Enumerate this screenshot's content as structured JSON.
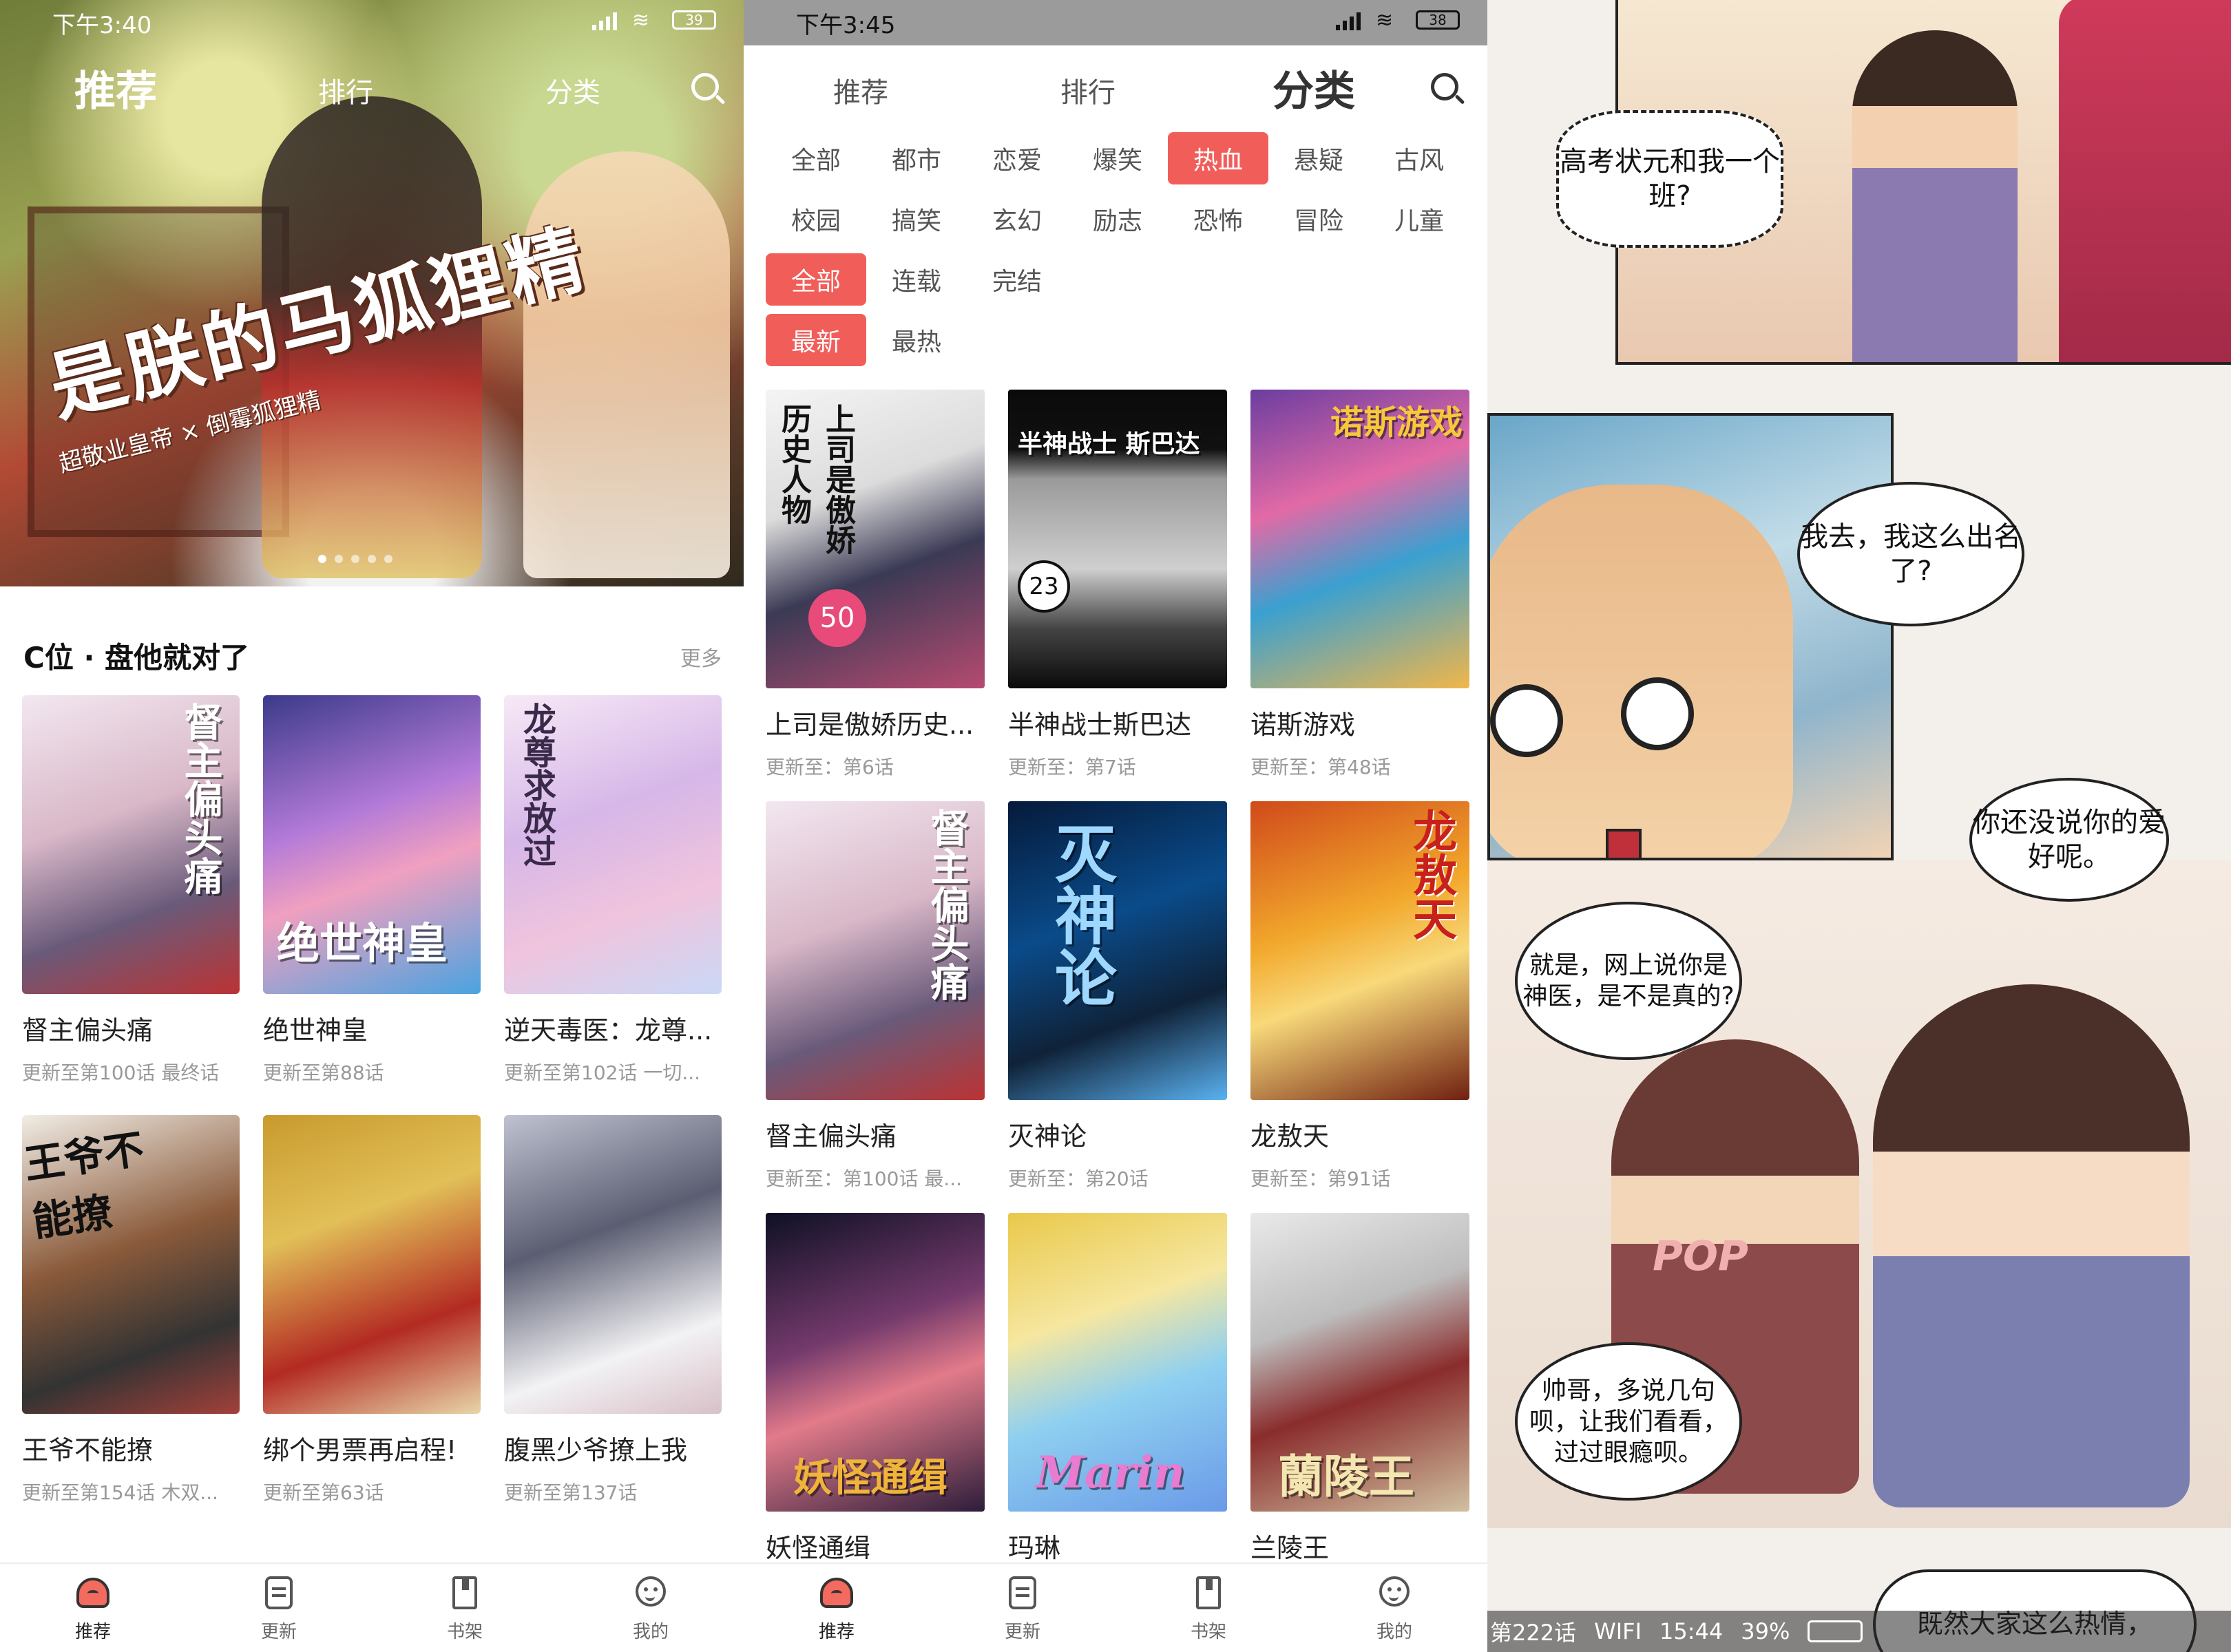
{
  "panel1": {
    "status_time": "下午3:40",
    "battery": "39",
    "nav": {
      "tab1": "推荐",
      "tab2": "排行",
      "tab3": "分类"
    },
    "banner": {
      "title": "是朕的马狐狸精",
      "subtitle": "超敬业皇帝 × 倒霉狐狸精"
    },
    "section": {
      "title": "C位 · 盘他就对了",
      "more": "更多"
    },
    "items": [
      {
        "title": "督主偏头痛",
        "sub": "更新至第100话 最终话",
        "cover_text": "督主偏头痛"
      },
      {
        "title": "绝世神皇",
        "sub": "更新至第88话",
        "cover_text": "绝世神皇"
      },
      {
        "title": "逆天毒医：龙尊...",
        "sub": "更新至第102话 一切...",
        "cover_text": "龙尊求放过"
      },
      {
        "title": "王爷不能撩",
        "sub": "更新至第154话 木双...",
        "cover_text": "王爷不能撩"
      },
      {
        "title": "绑个男票再启程!",
        "sub": "更新至第63话",
        "cover_text": ""
      },
      {
        "title": "腹黑少爷撩上我",
        "sub": "更新至第137话",
        "cover_text": ""
      }
    ],
    "bottom": [
      "推荐",
      "更新",
      "书架",
      "我的"
    ]
  },
  "panel2": {
    "status_time": "下午3:45",
    "battery": "38",
    "nav": {
      "tab1": "推荐",
      "tab2": "排行",
      "tab3": "分类"
    },
    "filters": {
      "row1": [
        "全部",
        "都市",
        "恋爱",
        "爆笑",
        "热血",
        "悬疑",
        "古风"
      ],
      "row2": [
        "校园",
        "搞笑",
        "玄幻",
        "励志",
        "恐怖",
        "冒险",
        "儿童"
      ],
      "row3": [
        "全部",
        "连载",
        "完结"
      ],
      "row4": [
        "最新",
        "最热"
      ]
    },
    "items": [
      {
        "title": "上司是傲娇历史...",
        "sub": "更新至：第6话",
        "cover_text": "上司是傲娇历史人物",
        "badge": "50"
      },
      {
        "title": "半神战士斯巴达",
        "sub": "更新至：第7话",
        "cover_text": "半神战士 斯巴达",
        "badge": "23"
      },
      {
        "title": "诺斯游戏",
        "sub": "更新至：第48话",
        "cover_text": "诺斯游戏"
      },
      {
        "title": "督主偏头痛",
        "sub": "更新至：第100话 最...",
        "cover_text": "督主偏头痛"
      },
      {
        "title": "灭神论",
        "sub": "更新至：第20话",
        "cover_text": "灭神论"
      },
      {
        "title": "龙敖天",
        "sub": "更新至：第91话",
        "cover_text": "龙敖天"
      },
      {
        "title": "妖怪通缉",
        "sub": "",
        "cover_text": "妖怪通缉"
      },
      {
        "title": "玛琳",
        "sub": "",
        "cover_text": "Marin"
      },
      {
        "title": "兰陵王",
        "sub": "",
        "cover_text": "蘭陵王"
      }
    ],
    "bottom": [
      "推荐",
      "更新",
      "书架",
      "我的"
    ]
  },
  "panel3": {
    "bubbles": {
      "b1": "高考状元和我一个班?",
      "b2": "我去，我这么出名了?",
      "b3": "你还没说你的爱好呢。",
      "b4": "就是，网上说你是神医，是不是真的?",
      "b5": "帅哥，多说几句呗，让我们看看，过过眼瘾呗。",
      "b6": "既然大家这么热情，"
    },
    "shirt": "POP",
    "status": {
      "chapter": "第222话",
      "wifi": "WIFI",
      "time": "15:44",
      "battery": "39%"
    }
  },
  "colors": {
    "accent": "#f15e5a"
  }
}
